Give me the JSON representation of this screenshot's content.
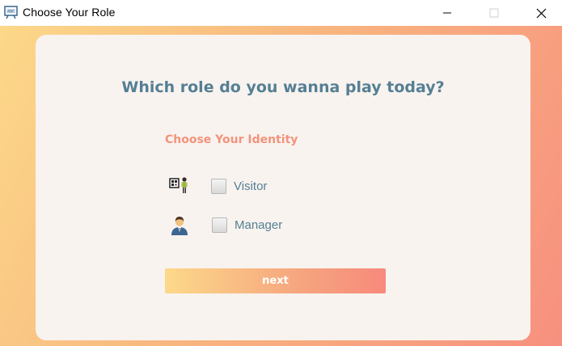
{
  "window": {
    "title": "Choose Your Role",
    "icon": "app-window-icon",
    "controls": [
      "minimize-icon",
      "maximize-icon",
      "close-icon"
    ]
  },
  "page": {
    "heading": "Which role do you wanna play today?",
    "subheading": "Choose Your Identity",
    "roles": [
      {
        "label": "Visitor",
        "icon": "visitor-icon",
        "checked": false
      },
      {
        "label": "Manager",
        "icon": "manager-icon",
        "checked": false
      }
    ],
    "next_label": "next"
  },
  "colors": {
    "heading": "#557f94",
    "subheading": "#f3937b",
    "card": "#f8f3ef",
    "gradient_start": "#fcd889",
    "gradient_end": "#f7907f"
  }
}
